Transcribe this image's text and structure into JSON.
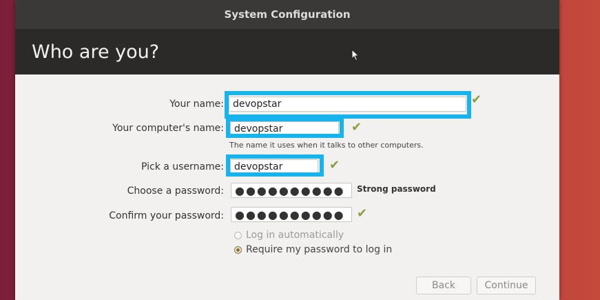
{
  "window": {
    "title": "System Configuration"
  },
  "header": {
    "title": "Who are you?"
  },
  "form": {
    "name_label": "Your name:",
    "name_value": "devopstar",
    "computer_label": "Your computer's name:",
    "computer_value": "devopstar",
    "computer_hint": "The name it uses when it talks to other computers.",
    "username_label": "Pick a username:",
    "username_value": "devopstar",
    "password_label": "Choose a password:",
    "password_value": "●●●●●●●●●●",
    "password_strength": "Strong password",
    "confirm_label": "Confirm your password:",
    "confirm_value": "●●●●●●●●●●",
    "login_auto": "Log in automatically",
    "login_require": "Require my password to log in"
  },
  "buttons": {
    "back": "Back",
    "continue": "Continue"
  },
  "colors": {
    "highlight": "#17b3ec",
    "check": "#8aa040"
  },
  "icons": {
    "check": "checkmark-icon",
    "cursor": "mouse-cursor-icon"
  }
}
